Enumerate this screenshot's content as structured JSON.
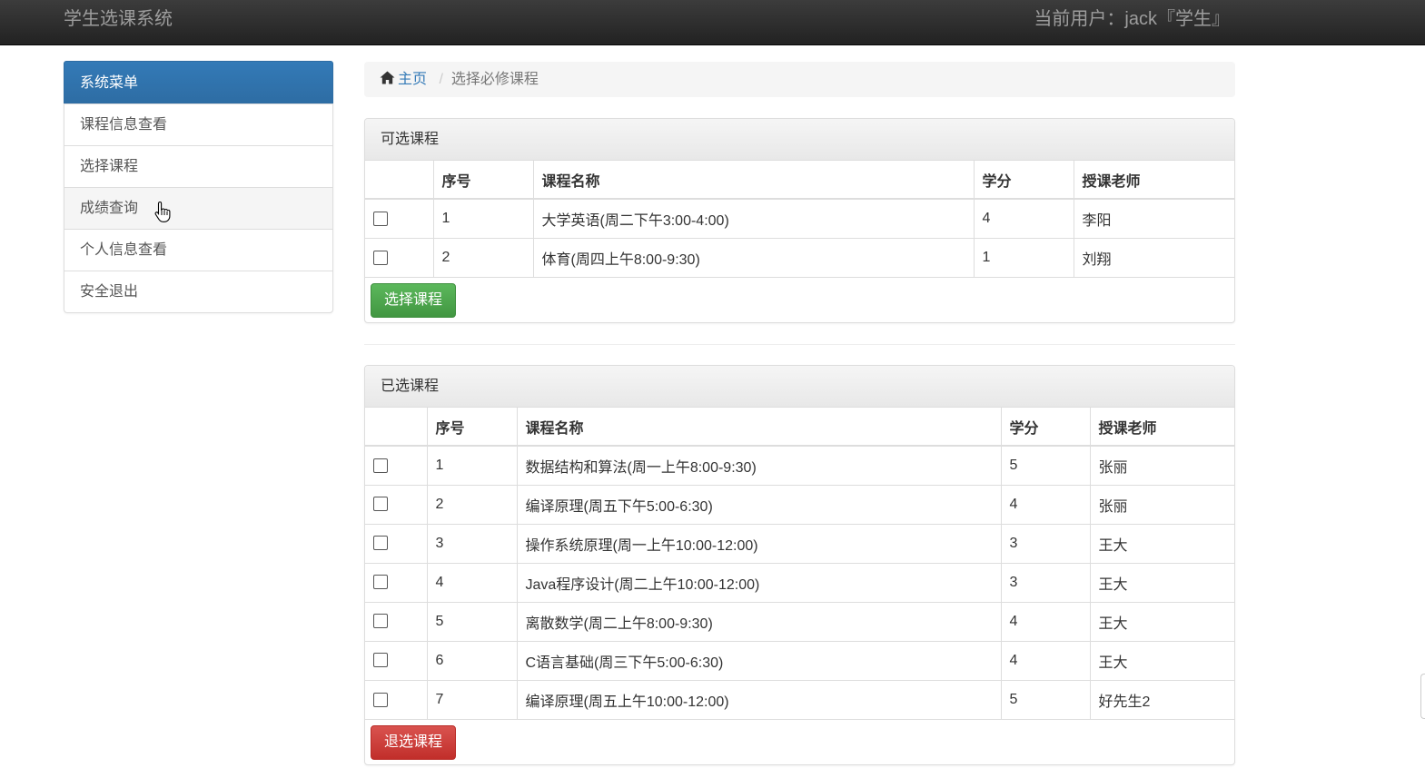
{
  "header": {
    "brand": "学生选课系统",
    "current_user": "当前用户：jack『学生』"
  },
  "sidebar": {
    "title": "系统菜单",
    "items": [
      {
        "label": "课程信息查看"
      },
      {
        "label": "选择课程"
      },
      {
        "label": "成绩查询"
      },
      {
        "label": "个人信息查看"
      },
      {
        "label": "安全退出"
      }
    ]
  },
  "breadcrumb": {
    "home": "主页",
    "separator": "/",
    "current": "选择必修课程"
  },
  "available": {
    "title": "可选课程",
    "columns": [
      "",
      "序号",
      "课程名称",
      "学分",
      "授课老师"
    ],
    "rows": [
      {
        "no": "1",
        "name": "大学英语(周二下午3:00-4:00)",
        "credit": "4",
        "teacher": "李阳"
      },
      {
        "no": "2",
        "name": "体育(周四上午8:00-9:30)",
        "credit": "1",
        "teacher": "刘翔"
      }
    ],
    "button": "选择课程"
  },
  "selected": {
    "title": "已选课程",
    "columns": [
      "",
      "序号",
      "课程名称",
      "学分",
      "授课老师"
    ],
    "rows": [
      {
        "no": "1",
        "name": "数据结构和算法(周一上午8:00-9:30)",
        "credit": "5",
        "teacher": "张丽"
      },
      {
        "no": "2",
        "name": "编译原理(周五下午5:00-6:30)",
        "credit": "4",
        "teacher": "张丽"
      },
      {
        "no": "3",
        "name": "操作系统原理(周一上午10:00-12:00)",
        "credit": "3",
        "teacher": "王大"
      },
      {
        "no": "4",
        "name": "Java程序设计(周二上午10:00-12:00)",
        "credit": "3",
        "teacher": "王大"
      },
      {
        "no": "5",
        "name": "离散数学(周二上午8:00-9:30)",
        "credit": "4",
        "teacher": "王大"
      },
      {
        "no": "6",
        "name": "C语言基础(周三下午5:00-6:30)",
        "credit": "4",
        "teacher": "王大"
      },
      {
        "no": "7",
        "name": "编译原理(周五上午10:00-12:00)",
        "credit": "5",
        "teacher": "好先生2"
      }
    ],
    "button": "退选课程"
  },
  "icons": {
    "home": "home-icon",
    "cursor": "hand-pointer-icon"
  },
  "colors": {
    "primary": "#337ab7",
    "success": "#5cb85c",
    "danger": "#d9534f",
    "navbar": "#222222"
  }
}
